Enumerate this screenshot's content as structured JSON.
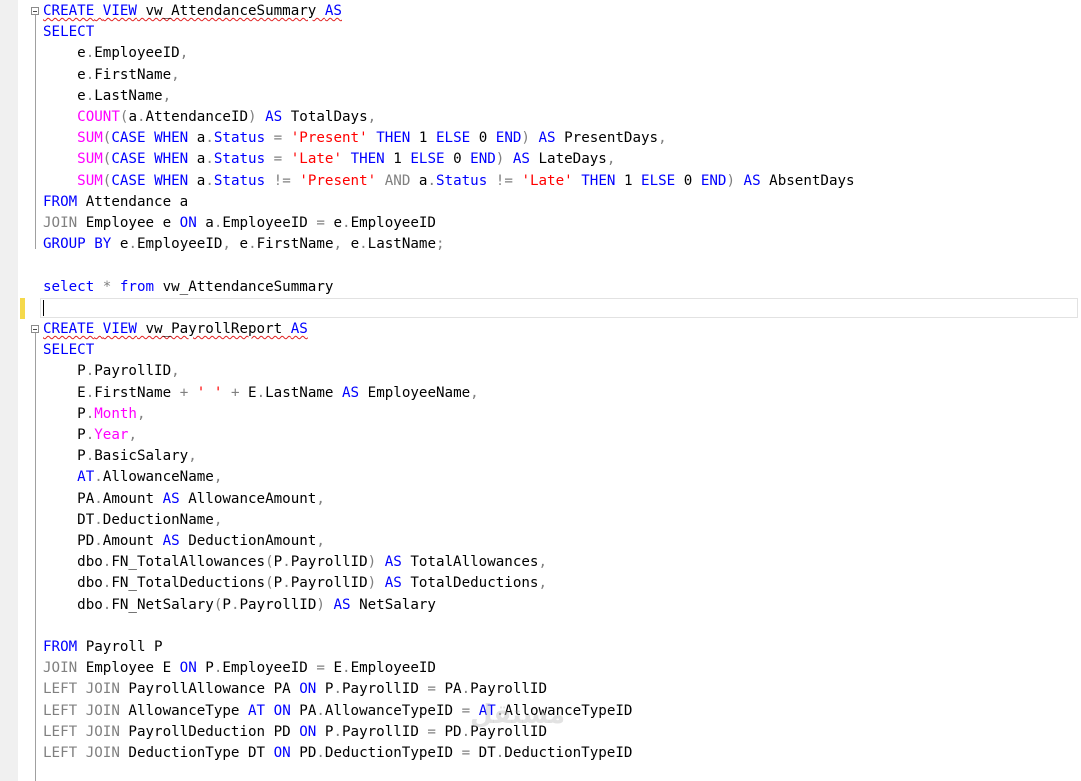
{
  "editor": {
    "lines": [
      [
        [
          "CREATE",
          "kw",
          "err"
        ],
        [
          " ",
          "id",
          "err"
        ],
        [
          "VIEW",
          "kw",
          "err"
        ],
        [
          " vw_AttendanceSummary ",
          "id",
          "err"
        ],
        [
          "AS",
          "kw",
          "err"
        ]
      ],
      [
        [
          "SELECT",
          "kw"
        ]
      ],
      [
        [
          "    e",
          "id"
        ],
        [
          ".",
          "op"
        ],
        [
          "EmployeeID",
          "id"
        ],
        [
          ",",
          "op"
        ]
      ],
      [
        [
          "    e",
          "id"
        ],
        [
          ".",
          "op"
        ],
        [
          "FirstName",
          "id"
        ],
        [
          ",",
          "op"
        ]
      ],
      [
        [
          "    e",
          "id"
        ],
        [
          ".",
          "op"
        ],
        [
          "LastName",
          "id"
        ],
        [
          ",",
          "op"
        ]
      ],
      [
        [
          "    ",
          "id"
        ],
        [
          "COUNT",
          "fn"
        ],
        [
          "(",
          "op"
        ],
        [
          "a",
          "id"
        ],
        [
          ".",
          "op"
        ],
        [
          "AttendanceID",
          "id"
        ],
        [
          ")",
          "op"
        ],
        [
          " ",
          "id"
        ],
        [
          "AS",
          "kw"
        ],
        [
          " TotalDays",
          "id"
        ],
        [
          ",",
          "op"
        ]
      ],
      [
        [
          "    ",
          "id"
        ],
        [
          "SUM",
          "fn"
        ],
        [
          "(",
          "op"
        ],
        [
          "CASE",
          "kw"
        ],
        [
          " ",
          "id"
        ],
        [
          "WHEN",
          "kw"
        ],
        [
          " a",
          "id"
        ],
        [
          ".",
          "op"
        ],
        [
          "Status",
          "kw"
        ],
        [
          " ",
          "id"
        ],
        [
          "=",
          "op"
        ],
        [
          " ",
          "id"
        ],
        [
          "'Present'",
          "str"
        ],
        [
          " ",
          "id"
        ],
        [
          "THEN",
          "kw"
        ],
        [
          " 1 ",
          "id"
        ],
        [
          "ELSE",
          "kw"
        ],
        [
          " 0 ",
          "id"
        ],
        [
          "END",
          "kw"
        ],
        [
          ")",
          "op"
        ],
        [
          " ",
          "id"
        ],
        [
          "AS",
          "kw"
        ],
        [
          " PresentDays",
          "id"
        ],
        [
          ",",
          "op"
        ]
      ],
      [
        [
          "    ",
          "id"
        ],
        [
          "SUM",
          "fn"
        ],
        [
          "(",
          "op"
        ],
        [
          "CASE",
          "kw"
        ],
        [
          " ",
          "id"
        ],
        [
          "WHEN",
          "kw"
        ],
        [
          " a",
          "id"
        ],
        [
          ".",
          "op"
        ],
        [
          "Status",
          "kw"
        ],
        [
          " ",
          "id"
        ],
        [
          "=",
          "op"
        ],
        [
          " ",
          "id"
        ],
        [
          "'Late'",
          "str"
        ],
        [
          " ",
          "id"
        ],
        [
          "THEN",
          "kw"
        ],
        [
          " 1 ",
          "id"
        ],
        [
          "ELSE",
          "kw"
        ],
        [
          " 0 ",
          "id"
        ],
        [
          "END",
          "kw"
        ],
        [
          ")",
          "op"
        ],
        [
          " ",
          "id"
        ],
        [
          "AS",
          "kw"
        ],
        [
          " LateDays",
          "id"
        ],
        [
          ",",
          "op"
        ]
      ],
      [
        [
          "    ",
          "id"
        ],
        [
          "SUM",
          "fn"
        ],
        [
          "(",
          "op"
        ],
        [
          "CASE",
          "kw"
        ],
        [
          " ",
          "id"
        ],
        [
          "WHEN",
          "kw"
        ],
        [
          " a",
          "id"
        ],
        [
          ".",
          "op"
        ],
        [
          "Status",
          "kw"
        ],
        [
          " ",
          "id"
        ],
        [
          "!=",
          "op"
        ],
        [
          " ",
          "id"
        ],
        [
          "'Present'",
          "str"
        ],
        [
          " ",
          "id"
        ],
        [
          "AND",
          "op"
        ],
        [
          " a",
          "id"
        ],
        [
          ".",
          "op"
        ],
        [
          "Status",
          "kw"
        ],
        [
          " ",
          "id"
        ],
        [
          "!=",
          "op"
        ],
        [
          " ",
          "id"
        ],
        [
          "'Late'",
          "str"
        ],
        [
          " ",
          "id"
        ],
        [
          "THEN",
          "kw"
        ],
        [
          " 1 ",
          "id"
        ],
        [
          "ELSE",
          "kw"
        ],
        [
          " 0 ",
          "id"
        ],
        [
          "END",
          "kw"
        ],
        [
          ")",
          "op"
        ],
        [
          " ",
          "id"
        ],
        [
          "AS",
          "kw"
        ],
        [
          " AbsentDays",
          "id"
        ]
      ],
      [
        [
          "FROM",
          "kw"
        ],
        [
          " Attendance a",
          "id"
        ]
      ],
      [
        [
          "JOIN",
          "op"
        ],
        [
          " Employee e ",
          "id"
        ],
        [
          "ON",
          "kw"
        ],
        [
          " a",
          "id"
        ],
        [
          ".",
          "op"
        ],
        [
          "EmployeeID ",
          "id"
        ],
        [
          "=",
          "op"
        ],
        [
          " e",
          "id"
        ],
        [
          ".",
          "op"
        ],
        [
          "EmployeeID",
          "id"
        ]
      ],
      [
        [
          "GROUP",
          "kw"
        ],
        [
          " ",
          "id"
        ],
        [
          "BY",
          "kw"
        ],
        [
          " e",
          "id"
        ],
        [
          ".",
          "op"
        ],
        [
          "EmployeeID",
          "id"
        ],
        [
          ",",
          "op"
        ],
        [
          " e",
          "id"
        ],
        [
          ".",
          "op"
        ],
        [
          "FirstName",
          "id"
        ],
        [
          ",",
          "op"
        ],
        [
          " e",
          "id"
        ],
        [
          ".",
          "op"
        ],
        [
          "LastName",
          "id"
        ],
        [
          ";",
          "op"
        ]
      ],
      [],
      [
        [
          "select",
          "kw"
        ],
        [
          " ",
          "id"
        ],
        [
          "*",
          "op"
        ],
        [
          " ",
          "id"
        ],
        [
          "from",
          "kw"
        ],
        [
          " vw_AttendanceSummary",
          "id"
        ]
      ],
      [],
      [
        [
          "CREATE",
          "kw",
          "err"
        ],
        [
          " ",
          "id",
          "err"
        ],
        [
          "VIEW",
          "kw",
          "err"
        ],
        [
          " vw_PayrollReport ",
          "id",
          "err"
        ],
        [
          "AS",
          "kw",
          "err"
        ]
      ],
      [
        [
          "SELECT",
          "kw"
        ]
      ],
      [
        [
          "    P",
          "id"
        ],
        [
          ".",
          "op"
        ],
        [
          "PayrollID",
          "id"
        ],
        [
          ",",
          "op"
        ]
      ],
      [
        [
          "    E",
          "id"
        ],
        [
          ".",
          "op"
        ],
        [
          "FirstName ",
          "id"
        ],
        [
          "+",
          "op"
        ],
        [
          " ",
          "id"
        ],
        [
          "' '",
          "str"
        ],
        [
          " ",
          "id"
        ],
        [
          "+",
          "op"
        ],
        [
          " E",
          "id"
        ],
        [
          ".",
          "op"
        ],
        [
          "LastName ",
          "id"
        ],
        [
          "AS",
          "kw"
        ],
        [
          " EmployeeName",
          "id"
        ],
        [
          ",",
          "op"
        ]
      ],
      [
        [
          "    P",
          "id"
        ],
        [
          ".",
          "op"
        ],
        [
          "Month",
          "fn"
        ],
        [
          ",",
          "op"
        ]
      ],
      [
        [
          "    P",
          "id"
        ],
        [
          ".",
          "op"
        ],
        [
          "Year",
          "fn"
        ],
        [
          ",",
          "op"
        ]
      ],
      [
        [
          "    P",
          "id"
        ],
        [
          ".",
          "op"
        ],
        [
          "BasicSalary",
          "id"
        ],
        [
          ",",
          "op"
        ]
      ],
      [
        [
          "    ",
          "id"
        ],
        [
          "AT",
          "kw"
        ],
        [
          ".",
          "op"
        ],
        [
          "AllowanceName",
          "id"
        ],
        [
          ",",
          "op"
        ]
      ],
      [
        [
          "    PA",
          "id"
        ],
        [
          ".",
          "op"
        ],
        [
          "Amount ",
          "id"
        ],
        [
          "AS",
          "kw"
        ],
        [
          " AllowanceAmount",
          "id"
        ],
        [
          ",",
          "op"
        ]
      ],
      [
        [
          "    DT",
          "id"
        ],
        [
          ".",
          "op"
        ],
        [
          "DeductionName",
          "id"
        ],
        [
          ",",
          "op"
        ]
      ],
      [
        [
          "    PD",
          "id"
        ],
        [
          ".",
          "op"
        ],
        [
          "Amount ",
          "id"
        ],
        [
          "AS",
          "kw"
        ],
        [
          " DeductionAmount",
          "id"
        ],
        [
          ",",
          "op"
        ]
      ],
      [
        [
          "    dbo",
          "id"
        ],
        [
          ".",
          "op"
        ],
        [
          "FN_TotalAllowances",
          "id"
        ],
        [
          "(",
          "op"
        ],
        [
          "P",
          "id"
        ],
        [
          ".",
          "op"
        ],
        [
          "PayrollID",
          "id"
        ],
        [
          ")",
          "op"
        ],
        [
          " ",
          "id"
        ],
        [
          "AS",
          "kw"
        ],
        [
          " TotalAllowances",
          "id"
        ],
        [
          ",",
          "op"
        ]
      ],
      [
        [
          "    dbo",
          "id"
        ],
        [
          ".",
          "op"
        ],
        [
          "FN_TotalDeductions",
          "id"
        ],
        [
          "(",
          "op"
        ],
        [
          "P",
          "id"
        ],
        [
          ".",
          "op"
        ],
        [
          "PayrollID",
          "id"
        ],
        [
          ")",
          "op"
        ],
        [
          " ",
          "id"
        ],
        [
          "AS",
          "kw"
        ],
        [
          " TotalDeductions",
          "id"
        ],
        [
          ",",
          "op"
        ]
      ],
      [
        [
          "    dbo",
          "id"
        ],
        [
          ".",
          "op"
        ],
        [
          "FN_NetSalary",
          "id"
        ],
        [
          "(",
          "op"
        ],
        [
          "P",
          "id"
        ],
        [
          ".",
          "op"
        ],
        [
          "PayrollID",
          "id"
        ],
        [
          ")",
          "op"
        ],
        [
          " ",
          "id"
        ],
        [
          "AS",
          "kw"
        ],
        [
          " NetSalary",
          "id"
        ]
      ],
      [],
      [
        [
          "FROM",
          "kw"
        ],
        [
          " Payroll P",
          "id"
        ]
      ],
      [
        [
          "JOIN",
          "op"
        ],
        [
          " Employee E ",
          "id"
        ],
        [
          "ON",
          "kw"
        ],
        [
          " P",
          "id"
        ],
        [
          ".",
          "op"
        ],
        [
          "EmployeeID ",
          "id"
        ],
        [
          "=",
          "op"
        ],
        [
          " E",
          "id"
        ],
        [
          ".",
          "op"
        ],
        [
          "EmployeeID",
          "id"
        ]
      ],
      [
        [
          "LEFT",
          "op"
        ],
        [
          " ",
          "id"
        ],
        [
          "JOIN",
          "op"
        ],
        [
          " PayrollAllowance PA ",
          "id"
        ],
        [
          "ON",
          "kw"
        ],
        [
          " P",
          "id"
        ],
        [
          ".",
          "op"
        ],
        [
          "PayrollID ",
          "id"
        ],
        [
          "=",
          "op"
        ],
        [
          " PA",
          "id"
        ],
        [
          ".",
          "op"
        ],
        [
          "PayrollID",
          "id"
        ]
      ],
      [
        [
          "LEFT",
          "op"
        ],
        [
          " ",
          "id"
        ],
        [
          "JOIN",
          "op"
        ],
        [
          " AllowanceType ",
          "id"
        ],
        [
          "AT",
          "kw"
        ],
        [
          " ",
          "id"
        ],
        [
          "ON",
          "kw"
        ],
        [
          " PA",
          "id"
        ],
        [
          ".",
          "op"
        ],
        [
          "AllowanceTypeID ",
          "id"
        ],
        [
          "=",
          "op"
        ],
        [
          " ",
          "id"
        ],
        [
          "AT",
          "kw"
        ],
        [
          ".",
          "op"
        ],
        [
          "AllowanceTypeID",
          "id"
        ]
      ],
      [
        [
          "LEFT",
          "op"
        ],
        [
          " ",
          "id"
        ],
        [
          "JOIN",
          "op"
        ],
        [
          " PayrollDeduction PD ",
          "id"
        ],
        [
          "ON",
          "kw"
        ],
        [
          " P",
          "id"
        ],
        [
          ".",
          "op"
        ],
        [
          "PayrollID ",
          "id"
        ],
        [
          "=",
          "op"
        ],
        [
          " PD",
          "id"
        ],
        [
          ".",
          "op"
        ],
        [
          "PayrollID",
          "id"
        ]
      ],
      [
        [
          "LEFT",
          "op"
        ],
        [
          " ",
          "id"
        ],
        [
          "JOIN",
          "op"
        ],
        [
          " DeductionType DT ",
          "id"
        ],
        [
          "ON",
          "kw"
        ],
        [
          " PD",
          "id"
        ],
        [
          ".",
          "op"
        ],
        [
          "DeductionTypeID ",
          "id"
        ],
        [
          "=",
          "op"
        ],
        [
          " DT",
          "id"
        ],
        [
          ".",
          "op"
        ],
        [
          "DeductionTypeID",
          "id"
        ]
      ]
    ]
  },
  "watermark": {
    "text": "مستقل"
  },
  "colors": {
    "keyword": "#0000ff",
    "function": "#ff00ff",
    "string": "#ff0000",
    "operator": "#808080",
    "identifier": "#000000",
    "change_marker": "#f5d94b"
  }
}
